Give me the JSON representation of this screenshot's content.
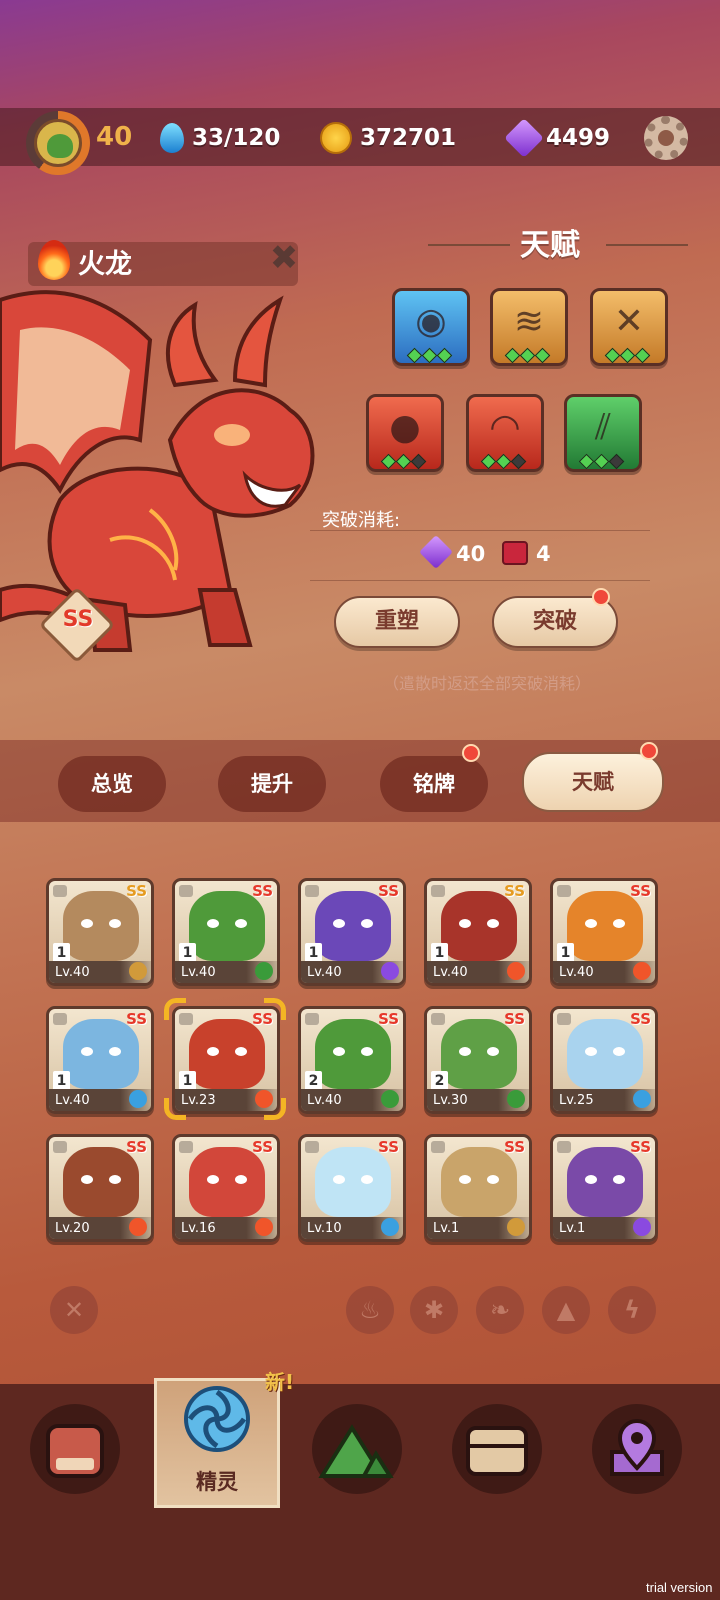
{
  "player": {
    "level": "40"
  },
  "resources": {
    "energy": "33/120",
    "coins": "372701",
    "gems": "4499"
  },
  "pet": {
    "name": "火龙",
    "rank": "SS"
  },
  "talent": {
    "title": "天赋",
    "icons": [
      {
        "name": "eye-icon",
        "color": "#2c6dc0",
        "pips": [
          true,
          true,
          true
        ]
      },
      {
        "name": "wing-crest-icon",
        "color": "#c47a28",
        "pips": [
          true,
          true,
          true
        ]
      },
      {
        "name": "cross-slash-icon",
        "color": "#c47a28",
        "pips": [
          true,
          true,
          true
        ]
      },
      {
        "name": "fireball-icon",
        "color": "#b8281c",
        "pips": [
          true,
          true,
          false
        ]
      },
      {
        "name": "fang-mouth-icon",
        "color": "#b8281c",
        "pips": [
          true,
          true,
          false
        ]
      },
      {
        "name": "claw-icon",
        "color": "#227a34",
        "pips": [
          true,
          true,
          false
        ]
      }
    ],
    "breakthrough_cost_label": "突破消耗:",
    "cost_gems": "40",
    "cost_books": "4",
    "reset_label": "重塑",
    "break_label": "突破",
    "hint": "（遣散时返还全部突破消耗）"
  },
  "tabs": [
    {
      "label": "总览"
    },
    {
      "label": "提升"
    },
    {
      "label": "铭牌"
    },
    {
      "label": "天赋"
    }
  ],
  "pets": [
    {
      "ss": "SS",
      "stars": "1",
      "lv": "Lv.40",
      "element": "earth",
      "color": "#b48a5e",
      "rainbow": true
    },
    {
      "ss": "SS",
      "stars": "1",
      "lv": "Lv.40",
      "element": "grass",
      "color": "#4f9a3a",
      "rainbow": false
    },
    {
      "ss": "SS",
      "stars": "1",
      "lv": "Lv.40",
      "element": "electric",
      "color": "#6b48b8",
      "rainbow": false
    },
    {
      "ss": "SS",
      "stars": "1",
      "lv": "Lv.40",
      "element": "fire",
      "color": "#a8342a",
      "rainbow": true
    },
    {
      "ss": "SS",
      "stars": "1",
      "lv": "Lv.40",
      "element": "fire",
      "color": "#e5842a",
      "rainbow": false
    },
    {
      "ss": "SS",
      "stars": "1",
      "lv": "Lv.40",
      "element": "ice",
      "color": "#7cb6e0",
      "rainbow": false
    },
    {
      "ss": "SS",
      "stars": "1",
      "lv": "Lv.23",
      "element": "fire",
      "color": "#c8412c",
      "rainbow": false
    },
    {
      "ss": "SS",
      "stars": "2",
      "lv": "Lv.40",
      "element": "grass",
      "color": "#4f9a3a",
      "rainbow": false
    },
    {
      "ss": "SS",
      "stars": "2",
      "lv": "Lv.30",
      "element": "grass",
      "color": "#5fa046",
      "rainbow": false
    },
    {
      "ss": "SS",
      "stars": "",
      "lv": "Lv.25",
      "element": "ice",
      "color": "#a9d3ee",
      "rainbow": false
    },
    {
      "ss": "SS",
      "stars": "",
      "lv": "Lv.20",
      "element": "fire",
      "color": "#9a4a2e",
      "rainbow": false
    },
    {
      "ss": "SS",
      "stars": "",
      "lv": "Lv.16",
      "element": "fire",
      "color": "#d2473a",
      "rainbow": false
    },
    {
      "ss": "SS",
      "stars": "",
      "lv": "Lv.10",
      "element": "ice",
      "color": "#bfe4f5",
      "rainbow": false
    },
    {
      "ss": "SS",
      "stars": "",
      "lv": "Lv.1",
      "element": "earth",
      "color": "#c9a46a",
      "rainbow": false
    },
    {
      "ss": "SS",
      "stars": "",
      "lv": "Lv.1",
      "element": "electric",
      "color": "#7a4aa8",
      "rainbow": false
    }
  ],
  "filters": [
    "clear-filter-icon",
    "fire-filter-icon",
    "ice-filter-icon",
    "grass-filter-icon",
    "earth-filter-icon",
    "electric-filter-icon"
  ],
  "nav": {
    "items": [
      "backpack-icon",
      "pets-icon",
      "explore-icon",
      "chest-icon",
      "map-icon"
    ],
    "active_label": "精灵",
    "new_badge": "新!"
  },
  "watermark": "trial version",
  "element_colors": {
    "fire": "#f0552a",
    "grass": "#3a9b3a",
    "electric": "#8a4ae0",
    "ice": "#3aa0e0",
    "earth": "#d19a3a"
  }
}
